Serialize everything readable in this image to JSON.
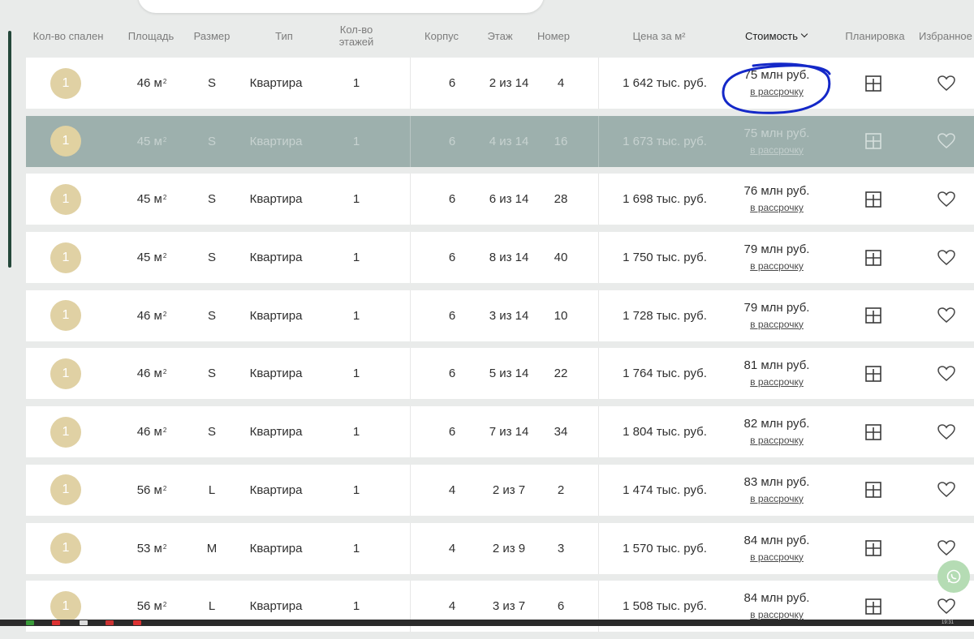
{
  "header": {
    "bedrooms": "Кол-во спален",
    "area": "Площадь",
    "size": "Размер",
    "type": "Тип",
    "floors_line1": "Кол-во",
    "floors_line2": "этажей",
    "building": "Корпус",
    "floor": "Этаж",
    "number": "Номер",
    "price_per_m2": "Цена за м²",
    "cost": "Стоимость",
    "layout": "Планировка",
    "favorites": "Избранное"
  },
  "installment_label": "в рассрочку",
  "area_unit": "м",
  "area_sup": "2",
  "rows": [
    {
      "bedrooms": "1",
      "area": "46",
      "size": "S",
      "type": "Квартира",
      "floors": "1",
      "building": "6",
      "floor": "2 из 14",
      "number": "4",
      "price_per_m2": "1 642 тыс. руб.",
      "cost": "75 млн руб.",
      "highlighted": false
    },
    {
      "bedrooms": "1",
      "area": "45",
      "size": "S",
      "type": "Квартира",
      "floors": "1",
      "building": "6",
      "floor": "4 из 14",
      "number": "16",
      "price_per_m2": "1 673 тыс. руб.",
      "cost": "75 млн руб.",
      "highlighted": true
    },
    {
      "bedrooms": "1",
      "area": "45",
      "size": "S",
      "type": "Квартира",
      "floors": "1",
      "building": "6",
      "floor": "6 из 14",
      "number": "28",
      "price_per_m2": "1 698 тыс. руб.",
      "cost": "76 млн руб.",
      "highlighted": false
    },
    {
      "bedrooms": "1",
      "area": "45",
      "size": "S",
      "type": "Квартира",
      "floors": "1",
      "building": "6",
      "floor": "8 из 14",
      "number": "40",
      "price_per_m2": "1 750 тыс. руб.",
      "cost": "79 млн руб.",
      "highlighted": false
    },
    {
      "bedrooms": "1",
      "area": "46",
      "size": "S",
      "type": "Квартира",
      "floors": "1",
      "building": "6",
      "floor": "3 из 14",
      "number": "10",
      "price_per_m2": "1 728 тыс. руб.",
      "cost": "79 млн руб.",
      "highlighted": false
    },
    {
      "bedrooms": "1",
      "area": "46",
      "size": "S",
      "type": "Квартира",
      "floors": "1",
      "building": "6",
      "floor": "5 из 14",
      "number": "22",
      "price_per_m2": "1 764 тыс. руб.",
      "cost": "81 млн руб.",
      "highlighted": false
    },
    {
      "bedrooms": "1",
      "area": "46",
      "size": "S",
      "type": "Квартира",
      "floors": "1",
      "building": "6",
      "floor": "7 из 14",
      "number": "34",
      "price_per_m2": "1 804 тыс. руб.",
      "cost": "82 млн руб.",
      "highlighted": false
    },
    {
      "bedrooms": "1",
      "area": "56",
      "size": "L",
      "type": "Квартира",
      "floors": "1",
      "building": "4",
      "floor": "2 из 7",
      "number": "2",
      "price_per_m2": "1 474 тыс. руб.",
      "cost": "83 млн руб.",
      "highlighted": false
    },
    {
      "bedrooms": "1",
      "area": "53",
      "size": "M",
      "type": "Квартира",
      "floors": "1",
      "building": "4",
      "floor": "2 из 9",
      "number": "3",
      "price_per_m2": "1 570 тыс. руб.",
      "cost": "84 млн руб.",
      "highlighted": false
    },
    {
      "bedrooms": "1",
      "area": "56",
      "size": "L",
      "type": "Квартира",
      "floors": "1",
      "building": "4",
      "floor": "3 из 7",
      "number": "6",
      "price_per_m2": "1 508 тыс. руб.",
      "cost": "84 млн руб.",
      "highlighted": false
    }
  ],
  "taskbar_time": "19:31",
  "icons": {
    "layout": "floor-plan-icon",
    "favorite": "heart-outline-icon",
    "sort": "chevron-down-icon",
    "chat": "whatsapp-icon"
  },
  "colors": {
    "badge": "#e0d1a4",
    "highlight_row": "#9db0ad",
    "accent_dark": "#24473a",
    "annotation": "#1428c8",
    "chat_button": "#b5dcb4"
  }
}
